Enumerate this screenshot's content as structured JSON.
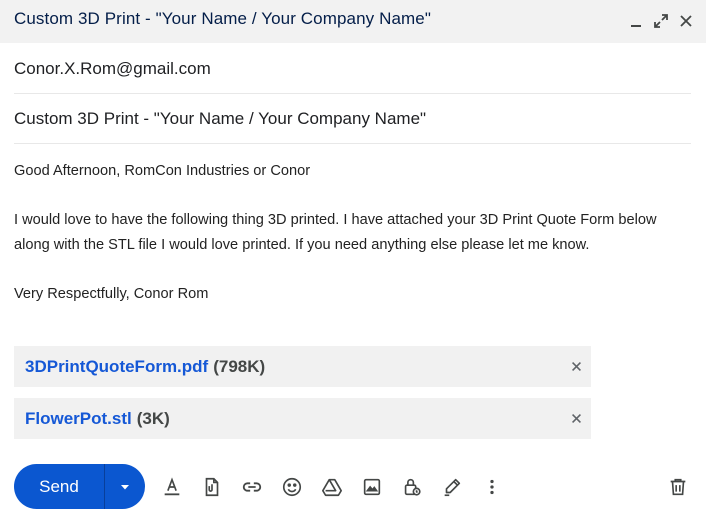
{
  "window": {
    "title": "Custom 3D Print - \"Your Name / Your Company Name\"",
    "icons": [
      "minimize-icon",
      "expand-icon",
      "close-icon"
    ]
  },
  "compose": {
    "to": "Conor.X.Rom@gmail.com",
    "subject": "Custom 3D Print - \"Your Name / Your Company Name\"",
    "body": {
      "greeting": "Good Afternoon, RomCon Industries or Conor",
      "line1": "I would love to have the following thing 3D printed. I have attached your 3D Print Quote Form below",
      "line2": "along with the STL file I would love printed. If you need anything else please let me know.",
      "closing": "Very Respectfully, Conor Rom"
    }
  },
  "attachments": [
    {
      "name": "3DPrintQuoteForm.pdf",
      "size": "(798K)"
    },
    {
      "name": "FlowerPot.stl",
      "size": "(3K)"
    }
  ],
  "toolbar": {
    "send_label": "Send",
    "icons": [
      "format-text-icon",
      "attach-file-icon",
      "insert-link-icon",
      "emoji-icon",
      "drive-icon",
      "insert-photo-icon",
      "confidential-mode-icon",
      "signature-icon",
      "more-options-icon",
      "discard-trash-icon"
    ],
    "colors": {
      "send": "#0b57d0",
      "link": "#1558d6",
      "icon": "#444746"
    }
  }
}
